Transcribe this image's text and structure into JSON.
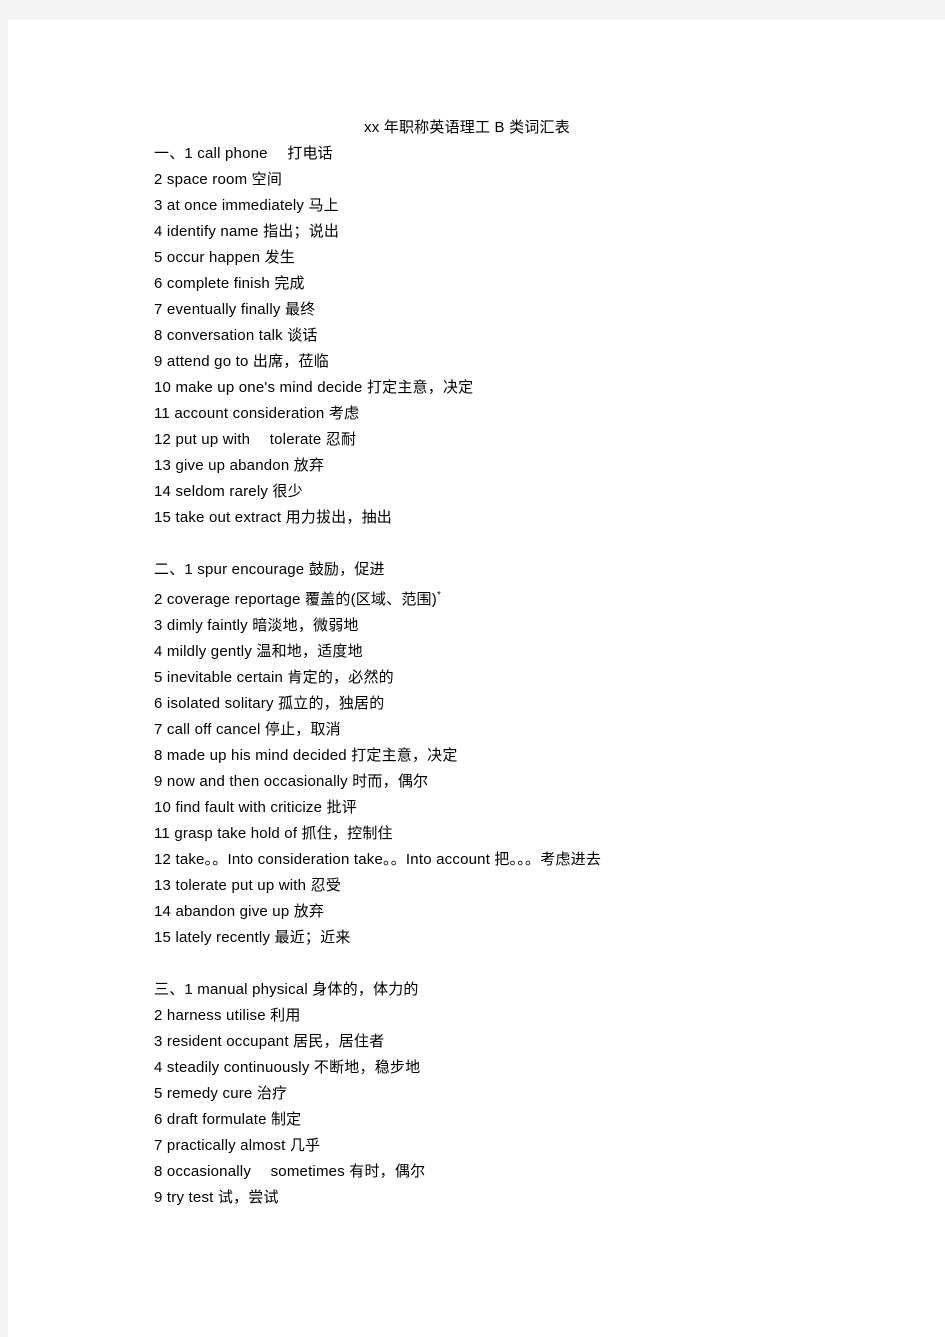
{
  "document": {
    "title": "xx 年职称英语理工 B 类词汇表",
    "sections": [
      {
        "marker": "一、",
        "entries": [
          "一、1 call phone　 打电话",
          "2 space room  空间",
          "3 at once immediately  马上",
          "4 identify name  指出；说出",
          "5 occur happen  发生",
          "6 complete finish  完成",
          "7 eventually finally  最终",
          "8 conversation talk  谈话",
          "9 attend go to  出席，莅临",
          "10 make up one's mind decide  打定主意，决定",
          "11 account consideration  考虑",
          "12 put up with　 tolerate  忍耐",
          "13 give up abandon  放弃",
          "14 seldom rarely  很少",
          "15 take out extract  用力拔出，抽出"
        ]
      },
      {
        "marker": "二、",
        "entries": [
          "二、1 spur encourage  鼓励，促进",
          "2 coverage reportage  覆盖的(区域、范围)",
          "3 dimly faintly  暗淡地，微弱地",
          "4 mildly gently  温和地，适度地",
          "5 inevitable certain  肯定的，必然的",
          "6 isolated solitary  孤立的，独居的",
          "7 call off cancel  停止，取消",
          "8 made up his mind decided  打定主意，决定",
          "9 now and then occasionally  时而，偶尔",
          "10 find fault with criticize  批评",
          "11 grasp take hold of  抓住，控制住",
          "12 take。。Into consideration take。。Into account  把。。。考虑进去",
          "13 tolerate put up with  忍受",
          "14 abandon give up  放弃",
          "15 lately recently  最近；近来"
        ],
        "footnote_mark": "*"
      },
      {
        "marker": "三、",
        "entries": [
          "三、1 manual physical  身体的，体力的",
          "2 harness utilise  利用",
          "3 resident occupant  居民，居住者",
          "4 steadily continuously  不断地，稳步地",
          "5 remedy cure  治疗",
          "6 draft formulate  制定",
          "7 practically almost  几乎",
          "8 occasionally　 sometimes  有时，偶尔",
          "9 try test  试，尝试"
        ]
      }
    ]
  },
  "colors": {
    "page_background": "#ffffff",
    "canvas_background": "#f4f4f4",
    "text": "#000000"
  }
}
